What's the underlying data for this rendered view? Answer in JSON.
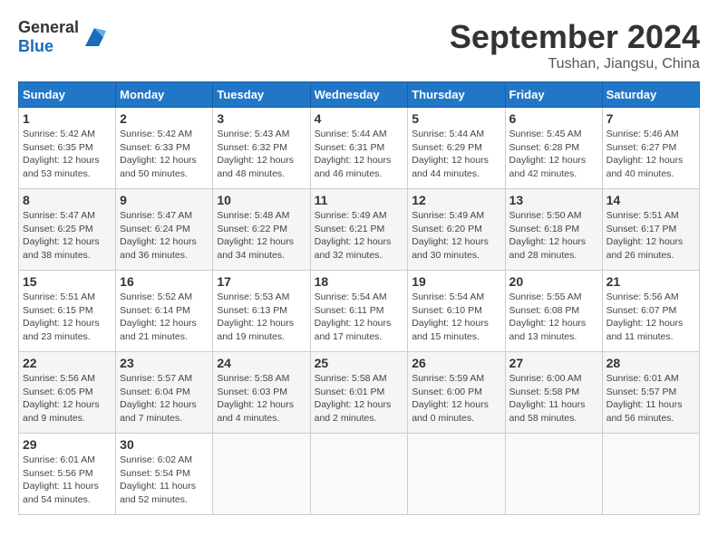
{
  "header": {
    "logo_general": "General",
    "logo_blue": "Blue",
    "title": "September 2024",
    "location": "Tushan, Jiangsu, China"
  },
  "days_of_week": [
    "Sunday",
    "Monday",
    "Tuesday",
    "Wednesday",
    "Thursday",
    "Friday",
    "Saturday"
  ],
  "weeks": [
    [
      {
        "day": "1",
        "sunrise": "5:42 AM",
        "sunset": "6:35 PM",
        "daylight": "12 hours and 53 minutes."
      },
      {
        "day": "2",
        "sunrise": "5:42 AM",
        "sunset": "6:33 PM",
        "daylight": "12 hours and 50 minutes."
      },
      {
        "day": "3",
        "sunrise": "5:43 AM",
        "sunset": "6:32 PM",
        "daylight": "12 hours and 48 minutes."
      },
      {
        "day": "4",
        "sunrise": "5:44 AM",
        "sunset": "6:31 PM",
        "daylight": "12 hours and 46 minutes."
      },
      {
        "day": "5",
        "sunrise": "5:44 AM",
        "sunset": "6:29 PM",
        "daylight": "12 hours and 44 minutes."
      },
      {
        "day": "6",
        "sunrise": "5:45 AM",
        "sunset": "6:28 PM",
        "daylight": "12 hours and 42 minutes."
      },
      {
        "day": "7",
        "sunrise": "5:46 AM",
        "sunset": "6:27 PM",
        "daylight": "12 hours and 40 minutes."
      }
    ],
    [
      {
        "day": "8",
        "sunrise": "5:47 AM",
        "sunset": "6:25 PM",
        "daylight": "12 hours and 38 minutes."
      },
      {
        "day": "9",
        "sunrise": "5:47 AM",
        "sunset": "6:24 PM",
        "daylight": "12 hours and 36 minutes."
      },
      {
        "day": "10",
        "sunrise": "5:48 AM",
        "sunset": "6:22 PM",
        "daylight": "12 hours and 34 minutes."
      },
      {
        "day": "11",
        "sunrise": "5:49 AM",
        "sunset": "6:21 PM",
        "daylight": "12 hours and 32 minutes."
      },
      {
        "day": "12",
        "sunrise": "5:49 AM",
        "sunset": "6:20 PM",
        "daylight": "12 hours and 30 minutes."
      },
      {
        "day": "13",
        "sunrise": "5:50 AM",
        "sunset": "6:18 PM",
        "daylight": "12 hours and 28 minutes."
      },
      {
        "day": "14",
        "sunrise": "5:51 AM",
        "sunset": "6:17 PM",
        "daylight": "12 hours and 26 minutes."
      }
    ],
    [
      {
        "day": "15",
        "sunrise": "5:51 AM",
        "sunset": "6:15 PM",
        "daylight": "12 hours and 23 minutes."
      },
      {
        "day": "16",
        "sunrise": "5:52 AM",
        "sunset": "6:14 PM",
        "daylight": "12 hours and 21 minutes."
      },
      {
        "day": "17",
        "sunrise": "5:53 AM",
        "sunset": "6:13 PM",
        "daylight": "12 hours and 19 minutes."
      },
      {
        "day": "18",
        "sunrise": "5:54 AM",
        "sunset": "6:11 PM",
        "daylight": "12 hours and 17 minutes."
      },
      {
        "day": "19",
        "sunrise": "5:54 AM",
        "sunset": "6:10 PM",
        "daylight": "12 hours and 15 minutes."
      },
      {
        "day": "20",
        "sunrise": "5:55 AM",
        "sunset": "6:08 PM",
        "daylight": "12 hours and 13 minutes."
      },
      {
        "day": "21",
        "sunrise": "5:56 AM",
        "sunset": "6:07 PM",
        "daylight": "12 hours and 11 minutes."
      }
    ],
    [
      {
        "day": "22",
        "sunrise": "5:56 AM",
        "sunset": "6:05 PM",
        "daylight": "12 hours and 9 minutes."
      },
      {
        "day": "23",
        "sunrise": "5:57 AM",
        "sunset": "6:04 PM",
        "daylight": "12 hours and 7 minutes."
      },
      {
        "day": "24",
        "sunrise": "5:58 AM",
        "sunset": "6:03 PM",
        "daylight": "12 hours and 4 minutes."
      },
      {
        "day": "25",
        "sunrise": "5:58 AM",
        "sunset": "6:01 PM",
        "daylight": "12 hours and 2 minutes."
      },
      {
        "day": "26",
        "sunrise": "5:59 AM",
        "sunset": "6:00 PM",
        "daylight": "12 hours and 0 minutes."
      },
      {
        "day": "27",
        "sunrise": "6:00 AM",
        "sunset": "5:58 PM",
        "daylight": "11 hours and 58 minutes."
      },
      {
        "day": "28",
        "sunrise": "6:01 AM",
        "sunset": "5:57 PM",
        "daylight": "11 hours and 56 minutes."
      }
    ],
    [
      {
        "day": "29",
        "sunrise": "6:01 AM",
        "sunset": "5:56 PM",
        "daylight": "11 hours and 54 minutes."
      },
      {
        "day": "30",
        "sunrise": "6:02 AM",
        "sunset": "5:54 PM",
        "daylight": "11 hours and 52 minutes."
      },
      null,
      null,
      null,
      null,
      null
    ]
  ]
}
